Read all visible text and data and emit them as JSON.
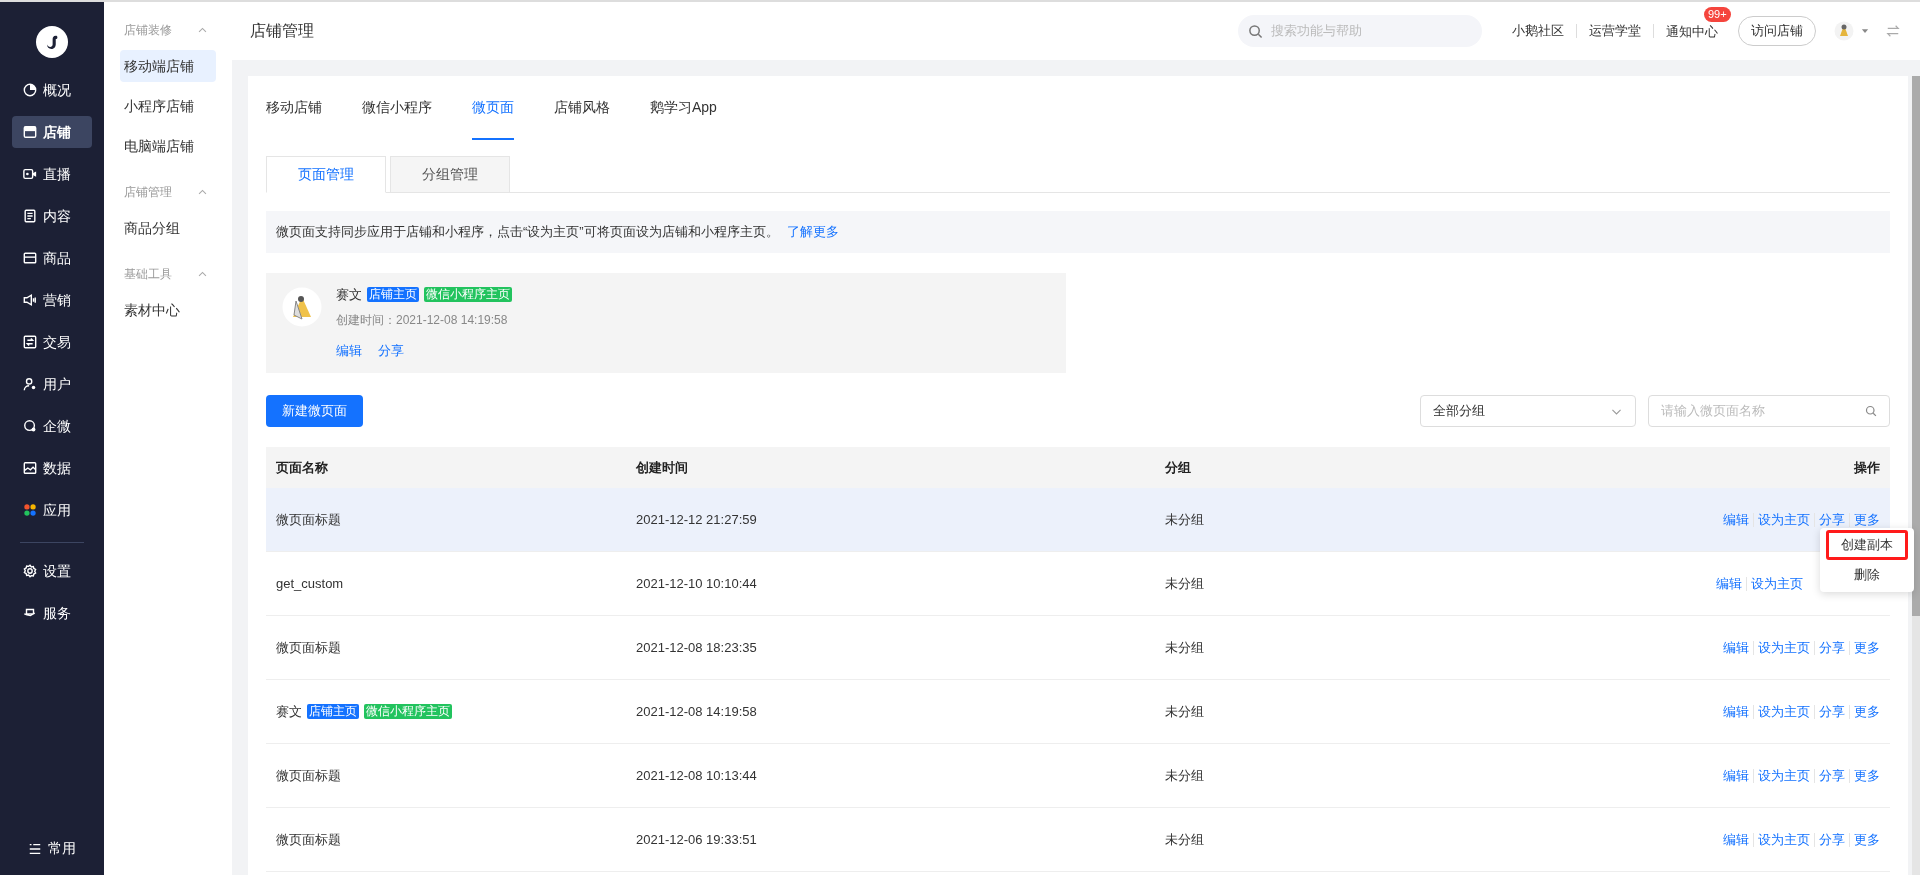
{
  "nav": {
    "items": [
      {
        "label": "概况",
        "selected": false
      },
      {
        "label": "店铺",
        "selected": true
      },
      {
        "label": "直播",
        "selected": false
      },
      {
        "label": "内容",
        "selected": false
      },
      {
        "label": "商品",
        "selected": false
      },
      {
        "label": "营销",
        "selected": false
      },
      {
        "label": "交易",
        "selected": false
      },
      {
        "label": "用户",
        "selected": false
      },
      {
        "label": "企微",
        "selected": false
      },
      {
        "label": "数据",
        "selected": false
      },
      {
        "label": "应用",
        "selected": false
      }
    ],
    "extra_items": [
      {
        "label": "设置",
        "selected": false
      },
      {
        "label": "服务",
        "selected": false
      }
    ],
    "bottom_item": "常用"
  },
  "subnav": [
    {
      "title": "店铺装修",
      "expanded": true,
      "items": [
        {
          "label": "移动端店铺",
          "selected": true
        },
        {
          "label": "小程序店铺",
          "selected": false
        },
        {
          "label": "电脑端店铺",
          "selected": false
        }
      ]
    },
    {
      "title": "店铺管理",
      "expanded": true,
      "items": [
        {
          "label": "商品分组",
          "selected": false
        }
      ]
    },
    {
      "title": "基础工具",
      "expanded": true,
      "items": [
        {
          "label": "素材中心",
          "selected": false
        }
      ]
    }
  ],
  "header": {
    "title": "店铺管理",
    "search": {
      "placeholder": "搜索功能与帮助"
    },
    "links": [
      "小鹅社区",
      "运营学堂",
      "通知中心"
    ],
    "notification_badge": "99+",
    "visit_button": "访问店铺"
  },
  "tabs": [
    {
      "label": "移动店铺",
      "selected": false
    },
    {
      "label": "微信小程序",
      "selected": false
    },
    {
      "label": "微页面",
      "selected": true
    },
    {
      "label": "店铺风格",
      "selected": false
    },
    {
      "label": "鹅学习App",
      "selected": false
    }
  ],
  "subtabs": [
    {
      "label": "页面管理",
      "selected": true
    },
    {
      "label": "分组管理",
      "selected": false
    }
  ],
  "notice": {
    "text": "微页面支持同步应用于店铺和小程序，点击“设为主页”可将页面设为店铺和小程序主页。",
    "link": "了解更多"
  },
  "featured": {
    "name": "赛文",
    "tags": [
      {
        "label": "店铺主页",
        "color": "#1472ff"
      },
      {
        "label": "微信小程序主页",
        "color": "#22c35e"
      }
    ],
    "created": "创建时间：2021-12-08 14:19:58",
    "actions": [
      "编辑",
      "分享"
    ]
  },
  "toolbar": {
    "new_button": "新建微页面",
    "group_select": "全部分组",
    "search": {
      "placeholder": "请输入微页面名称"
    }
  },
  "table": {
    "columns": [
      "页面名称",
      "创建时间",
      "分组",
      "操作"
    ],
    "rows": [
      {
        "name": "微页面标题",
        "tags": [],
        "time": "2021-12-12 21:27:59",
        "group": "未分组",
        "actions": [
          "编辑",
          "设为主页",
          "分享",
          "更多"
        ],
        "selected": true
      },
      {
        "name": "get_custom",
        "tags": [],
        "time": "2021-12-10 10:10:44",
        "group": "未分组",
        "actions": [
          "编辑",
          "设为主页"
        ],
        "selected": false
      },
      {
        "name": "微页面标题",
        "tags": [],
        "time": "2021-12-08 18:23:35",
        "group": "未分组",
        "actions": [
          "编辑",
          "设为主页",
          "分享",
          "更多"
        ],
        "selected": false
      },
      {
        "name": "赛文",
        "tags": [
          {
            "label": "店铺主页",
            "color": "#1472ff"
          },
          {
            "label": "微信小程序主页",
            "color": "#22c35e"
          }
        ],
        "time": "2021-12-08 14:19:58",
        "group": "未分组",
        "actions": [
          "编辑",
          "设为主页",
          "分享",
          "更多"
        ],
        "selected": false
      },
      {
        "name": "微页面标题",
        "tags": [],
        "time": "2021-12-08 10:13:44",
        "group": "未分组",
        "actions": [
          "编辑",
          "设为主页",
          "分享",
          "更多"
        ],
        "selected": false
      },
      {
        "name": "微页面标题",
        "tags": [],
        "time": "2021-12-06 19:33:51",
        "group": "未分组",
        "actions": [
          "编辑",
          "设为主页",
          "分享",
          "更多"
        ],
        "selected": false
      }
    ]
  },
  "dropdown": {
    "items": [
      {
        "label": "创建副本",
        "outlined": true
      },
      {
        "label": "删除",
        "outlined": false
      }
    ]
  }
}
